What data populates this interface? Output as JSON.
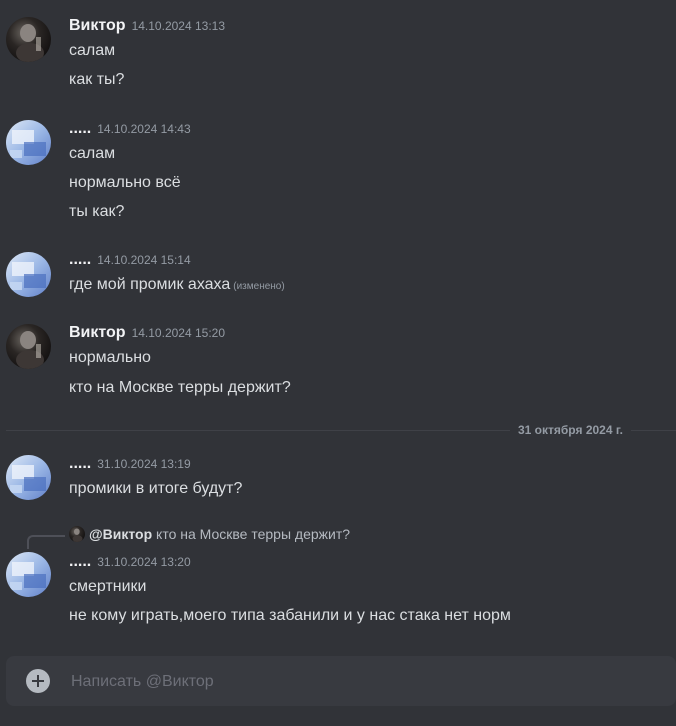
{
  "messages": [
    {
      "author": "Виктор",
      "timestamp": "14.10.2024 13:13",
      "avatar": "dark-figure-avatar",
      "lines": [
        "салам",
        "как ты?"
      ]
    },
    {
      "author": ".....",
      "timestamp": "14.10.2024 14:43",
      "avatar": "blue-image-avatar",
      "lines": [
        "салам",
        "нормально всё",
        "ты как?"
      ]
    },
    {
      "author": ".....",
      "timestamp": "14.10.2024 15:14",
      "avatar": "blue-image-avatar",
      "lines": [
        "где мой промик ахаха"
      ],
      "edited": "(изменено)"
    },
    {
      "author": "Виктор",
      "timestamp": "14.10.2024 15:20",
      "avatar": "dark-figure-avatar",
      "lines": [
        "нормально",
        "кто на Москве терры держит?"
      ]
    },
    {
      "author": ".....",
      "timestamp": "31.10.2024 13:19",
      "avatar": "blue-image-avatar",
      "lines": [
        "промики в итоге будут?"
      ]
    },
    {
      "author": ".....",
      "timestamp": "31.10.2024 13:20",
      "avatar": "blue-image-avatar",
      "reply": {
        "author": "@Виктор",
        "text": "кто на Москве терры держит?"
      },
      "lines": [
        "смертники",
        "не кому играть,моего типа забанили и у нас стака нет норм"
      ]
    }
  ],
  "date_divider": "31 октября 2024 г.",
  "composer": {
    "placeholder": "Написать @Виктор",
    "add_icon": "plus-circle-icon"
  },
  "colors": {
    "background": "#313338",
    "composer_background": "#383a40",
    "text": "#dbdee1",
    "muted": "#949ba4"
  }
}
